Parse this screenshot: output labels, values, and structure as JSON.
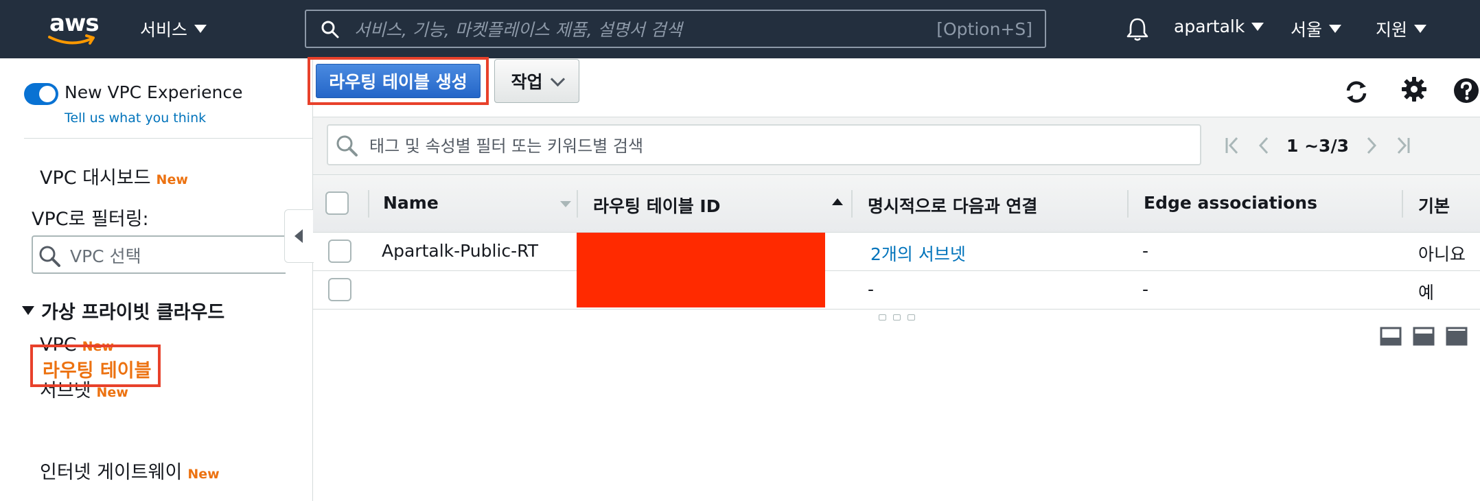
{
  "topnav": {
    "logo_text": "aws",
    "services_label": "서비스",
    "search_placeholder": "서비스, 기능, 마켓플레이스 제품, 설명서 검색",
    "search_shortcut": "[Option+S]",
    "account_label": "apartalk",
    "region_label": "서울",
    "support_label": "지원"
  },
  "sidebar": {
    "toggle_label": "New VPC Experience",
    "feedback_link": "Tell us what you think",
    "dashboard_label": "VPC 대시보드",
    "new_badge": "New",
    "filter_label": "VPC로 필터링:",
    "vpc_select_placeholder": "VPC 선택",
    "section_title": "가상 프라이빗 클라우드",
    "items": [
      {
        "label": "VPC",
        "badge": "New"
      },
      {
        "label": "서브넷",
        "badge": "New"
      },
      {
        "label": "라우팅 테이블",
        "badge": ""
      },
      {
        "label": "인터넷 게이트웨이",
        "badge": "New"
      }
    ]
  },
  "toolbar": {
    "create_label": "라우팅 테이블 생성",
    "actions_label": "작업"
  },
  "filter": {
    "placeholder": "태그 및 속성별 필터 또는 키워드별 검색",
    "pagination": "1 ~3/3"
  },
  "table": {
    "columns": [
      "Name",
      "라우팅 테이블 ID",
      "명시적으로 다음과 연결",
      "Edge associations",
      "기본"
    ],
    "rows": [
      {
        "name": "Apartalk-Public-RT",
        "id": "",
        "explicit": "2개의 서브넷",
        "edge": "-",
        "main": "아니요"
      },
      {
        "name": "",
        "id": "",
        "explicit": "-",
        "edge": "-",
        "main": "예"
      }
    ]
  },
  "colors": {
    "nav_bg": "#232f3e",
    "primary": "#2466c8",
    "highlight": "#e8412b",
    "accent_orange": "#ec7211",
    "link": "#0073bb",
    "redaction": "#ff2a00"
  }
}
